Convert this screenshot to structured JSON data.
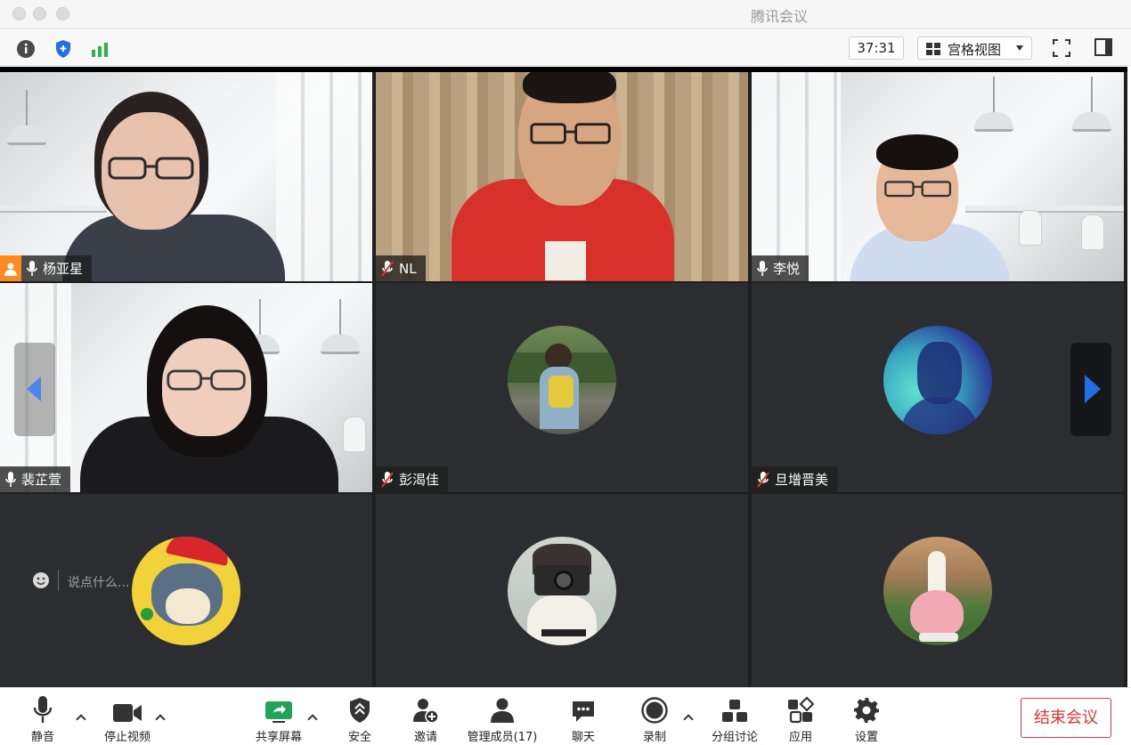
{
  "window": {
    "title": "腾讯会议"
  },
  "infobar": {
    "timer": "37:31",
    "view_mode": "宫格视图",
    "icons": [
      "info-icon",
      "shield-icon",
      "signal-icon",
      "fullscreen-icon",
      "side-panel-icon"
    ],
    "colors": {
      "shield": "#1f6fe5",
      "signal": "#2bb24c"
    }
  },
  "participants": [
    {
      "name": "杨亚星",
      "mic": "on",
      "host": true,
      "type": "video"
    },
    {
      "name": "NL",
      "mic": "muted",
      "type": "video"
    },
    {
      "name": "李悦",
      "mic": "on",
      "type": "video",
      "active_speaker": true
    },
    {
      "name": "裴芷萱",
      "mic": "on",
      "type": "video"
    },
    {
      "name": "彭渴佳",
      "mic": "muted",
      "type": "avatar"
    },
    {
      "name": "旦增晋美",
      "mic": "muted",
      "type": "avatar"
    },
    {
      "name": "",
      "mic": "muted",
      "type": "avatar"
    },
    {
      "name": "",
      "mic": "muted",
      "type": "avatar"
    },
    {
      "name": "",
      "mic": "muted",
      "type": "avatar"
    }
  ],
  "chat": {
    "placeholder": "说点什么..."
  },
  "toolbar": {
    "mute": "静音",
    "stop_video": "停止视频",
    "share_screen": "共享屏幕",
    "security": "安全",
    "invite": "邀请",
    "manage_members": "管理成员(17)",
    "chat": "聊天",
    "record": "录制",
    "breakout": "分组讨论",
    "apps": "应用",
    "settings": "设置",
    "end_meeting": "结束会议"
  },
  "accent_colors": {
    "active_border": "#2dbf6b",
    "end_button": "#e23434",
    "nav_arrow": "#1f6fe5",
    "host_badge": "#ff8a1f"
  }
}
